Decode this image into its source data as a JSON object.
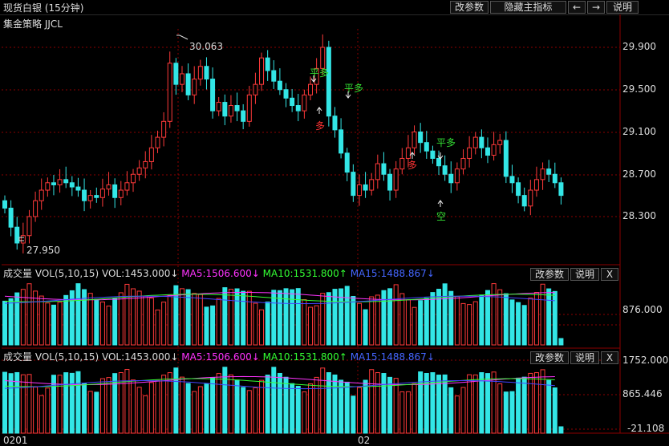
{
  "window": {
    "title": "现货白银 (15分钟)",
    "buttons": [
      "改参数",
      "隐藏主指标",
      "←",
      "→",
      "说明"
    ]
  },
  "main": {
    "strategy_label": "集金策略 JJCL",
    "high_label": "30.063",
    "low_label": "27.950",
    "y_ticks": [
      "29.900",
      "29.500",
      "29.100",
      "28.700",
      "28.300"
    ],
    "signals": [
      {
        "text": "平多",
        "color": "#33dd33"
      },
      {
        "text": "平多",
        "color": "#33dd33"
      },
      {
        "text": "多",
        "color": "#ff3333"
      },
      {
        "text": "多",
        "color": "#ff3333"
      },
      {
        "text": "平多",
        "color": "#33dd33"
      },
      {
        "text": "空",
        "color": "#33dd33"
      }
    ]
  },
  "panels": [
    {
      "name": "成交量",
      "formula": "VOL(5,10,15)",
      "vol": "VOL:1453.000↓",
      "ma5": "MA5:1506.600↓",
      "ma10": "MA10:1531.800↑",
      "ma15": "MA15:1488.867↓",
      "buttons": [
        "改参数",
        "说明",
        "X"
      ],
      "y_ticks": [
        "876.000"
      ]
    },
    {
      "name": "成交量",
      "formula": "VOL(5,10,15)",
      "vol": "VOL:1453.000↓",
      "ma5": "MA5:1506.600↓",
      "ma10": "MA10:1531.800↑",
      "ma15": "MA15:1488.867↓",
      "buttons": [
        "改参数",
        "说明",
        "X"
      ],
      "y_ticks": [
        "1752.000",
        "865.446",
        "-21.108"
      ]
    }
  ],
  "x_ticks": [
    "0201",
    "02"
  ],
  "colors": {
    "up": "#ff3a3a",
    "down": "#33e6e6",
    "ma5": "#ff33ff",
    "ma10": "#33ff33",
    "ma15": "#4444ff",
    "grid": "#8b0000"
  },
  "chart_data": {
    "type": "candlestick",
    "closes": [
      28.38,
      28.2,
      28.05,
      28.12,
      28.3,
      28.45,
      28.55,
      28.62,
      28.6,
      28.65,
      28.62,
      28.58,
      28.55,
      28.45,
      28.5,
      28.48,
      28.56,
      28.6,
      28.48,
      28.55,
      28.62,
      28.7,
      28.76,
      28.82,
      28.95,
      29.05,
      29.2,
      29.75,
      29.55,
      29.65,
      29.45,
      29.6,
      29.72,
      29.6,
      29.3,
      29.38,
      29.25,
      29.35,
      29.3,
      29.2,
      29.45,
      29.55,
      29.8,
      29.68,
      29.58,
      29.5,
      29.42,
      29.35,
      29.3,
      29.45,
      29.55,
      29.7,
      29.9,
      29.25,
      29.12,
      28.9,
      28.72,
      28.5,
      28.6,
      28.55,
      28.65,
      28.8,
      28.7,
      28.55,
      28.75,
      28.85,
      28.95,
      29.1,
      29.0,
      28.92,
      28.85,
      28.78,
      28.7,
      28.62,
      28.75,
      28.85,
      28.95,
      29.05,
      28.95,
      28.88,
      28.98,
      29.02,
      28.68,
      28.62,
      28.5,
      28.4,
      28.55,
      28.65,
      28.75,
      28.7,
      28.62,
      28.5
    ],
    "y_high_marker": 30.063,
    "y_low_marker": 27.95,
    "volume_ma": {
      "VOL": 1453.0,
      "MA5": 1506.6,
      "MA10": 1531.8,
      "MA15": 1488.867
    }
  }
}
